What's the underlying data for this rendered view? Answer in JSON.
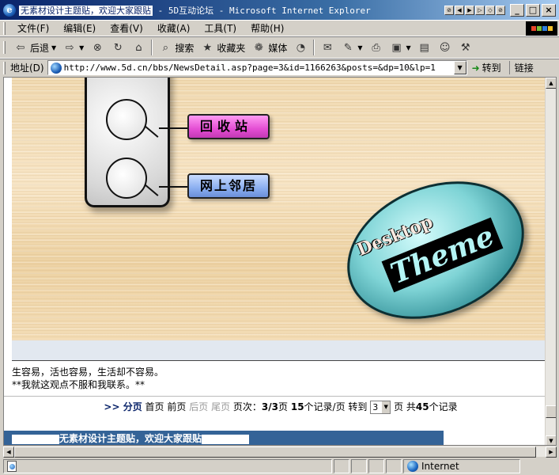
{
  "window": {
    "title_highlight": "无素材设计主题贴，欢迎大家跟贴",
    "title_rest": " - 5D互动论坛 - Microsoft Internet Explorer",
    "controls": [
      "_",
      "□",
      "×"
    ]
  },
  "menu": [
    {
      "label": "文件(F)"
    },
    {
      "label": "编辑(E)"
    },
    {
      "label": "查看(V)"
    },
    {
      "label": "收藏(A)"
    },
    {
      "label": "工具(T)"
    },
    {
      "label": "帮助(H)"
    }
  ],
  "toolbar": {
    "back": "后退",
    "search": "搜索",
    "favorites": "收藏夹",
    "media": "媒体"
  },
  "address": {
    "label": "地址(D)",
    "url": "http://www.5d.cn/bbs/NewsDetail.asp?page=3&id=1166263&posts=&dp=10&lp=1",
    "go": "转到",
    "links": "链接"
  },
  "content": {
    "recycle_label": "回收站",
    "network_label": "网上邻居",
    "badge_desktop": "Desktop",
    "badge_theme": "Theme",
    "post_line1": "生容易，活也容易，生活却不容易。",
    "post_line2": "**我就这观点不服和我联系。**"
  },
  "pager": {
    "prefix": ">> ",
    "title": "分页",
    "first": "首页",
    "prev": "前页",
    "next": "后页",
    "last": "尾页",
    "page_label": "页次：",
    "page_value": "3/3",
    "page_unit": "页 ",
    "records_per_page": "15",
    "records_suffix": "个记录/页 转到",
    "select_value": "3",
    "total_prefix": "页 共",
    "total_count": "45",
    "total_suffix": "个记录"
  },
  "footer": {
    "title": "无素材设计主题贴，欢迎大家跟贴"
  },
  "status": {
    "zone": "Internet"
  }
}
